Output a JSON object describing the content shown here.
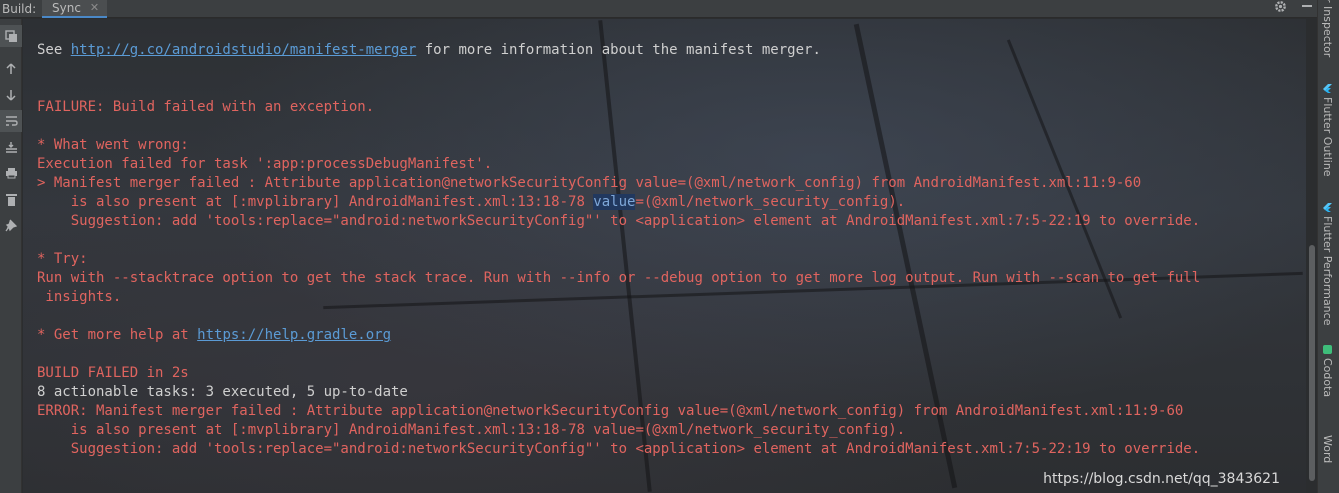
{
  "topbar": {
    "build_label": "Build:",
    "tab_label": "Sync",
    "tab_close": "✕",
    "settings_icon": "gear-icon",
    "minimize_icon": "minimize-icon"
  },
  "left_toolbar": {
    "icons": [
      "restore-layout-icon",
      "up-arrow-icon",
      "down-arrow-icon",
      "soft-wrap-icon",
      "scroll-to-end-icon",
      "print-icon",
      "delete-icon",
      "pin-icon"
    ]
  },
  "right_bar": {
    "items": [
      {
        "label": "r Inspector",
        "icon": ""
      },
      {
        "label": "Flutter Outline",
        "icon": "flutter-icon"
      },
      {
        "label": "Flutter Performance",
        "icon": "flutter-icon"
      },
      {
        "label": "Codota",
        "icon": "codota-icon"
      },
      {
        "label": "Word",
        "icon": ""
      }
    ]
  },
  "console": {
    "see_prefix": "See ",
    "see_link": "http://g.co/androidstudio/manifest-merger",
    "see_suffix": " for more information about the manifest merger.",
    "failure": "FAILURE: Build failed with an exception.",
    "what_wrong": "* What went wrong:",
    "exec_failed": "Execution failed for task ':app:processDebugManifest'.",
    "merger1": "> Manifest merger failed : Attribute application@networkSecurityConfig value=(@xml/network_config) from AndroidManifest.xml:11:9-60",
    "also1_prefix": "    is also present at [:mvplibrary] AndroidManifest.xml:13:18-78 ",
    "also1_hl": "value",
    "also1_suffix": "=(@xml/network_security_config).",
    "suggest1": "    Suggestion: add 'tools:replace=\"android:networkSecurityConfig\"' to <application> element at AndroidManifest.xml:7:5-22:19 to override.",
    "try": "* Try:",
    "run_with": "Run with --stacktrace option to get the stack trace. Run with --info or --debug option to get more log output. Run with --scan to get full",
    "insights": " insights.",
    "help_prefix": "* Get more help at ",
    "help_link": "https://help.gradle.org",
    "build_failed": "BUILD FAILED in 2s",
    "tasks": "8 actionable tasks: 3 executed, 5 up-to-date",
    "error": "ERROR: Manifest merger failed : Attribute application@networkSecurityConfig value=(@xml/network_config) from AndroidManifest.xml:11:9-60",
    "also2": "    is also present at [:mvplibrary] AndroidManifest.xml:13:18-78 value=(@xml/network_security_config).",
    "suggest2": "    Suggestion: add 'tools:replace=\"android:networkSecurityConfig\"' to <application> element at AndroidManifest.xml:7:5-22:19 to override."
  },
  "watermark": "https://blog.csdn.net/qq_3843621",
  "colors": {
    "error_text": "#e0645f",
    "normal_text": "#cfcfcf",
    "link": "#5b9bd5",
    "toolbar_bg": "#3c3f41"
  }
}
